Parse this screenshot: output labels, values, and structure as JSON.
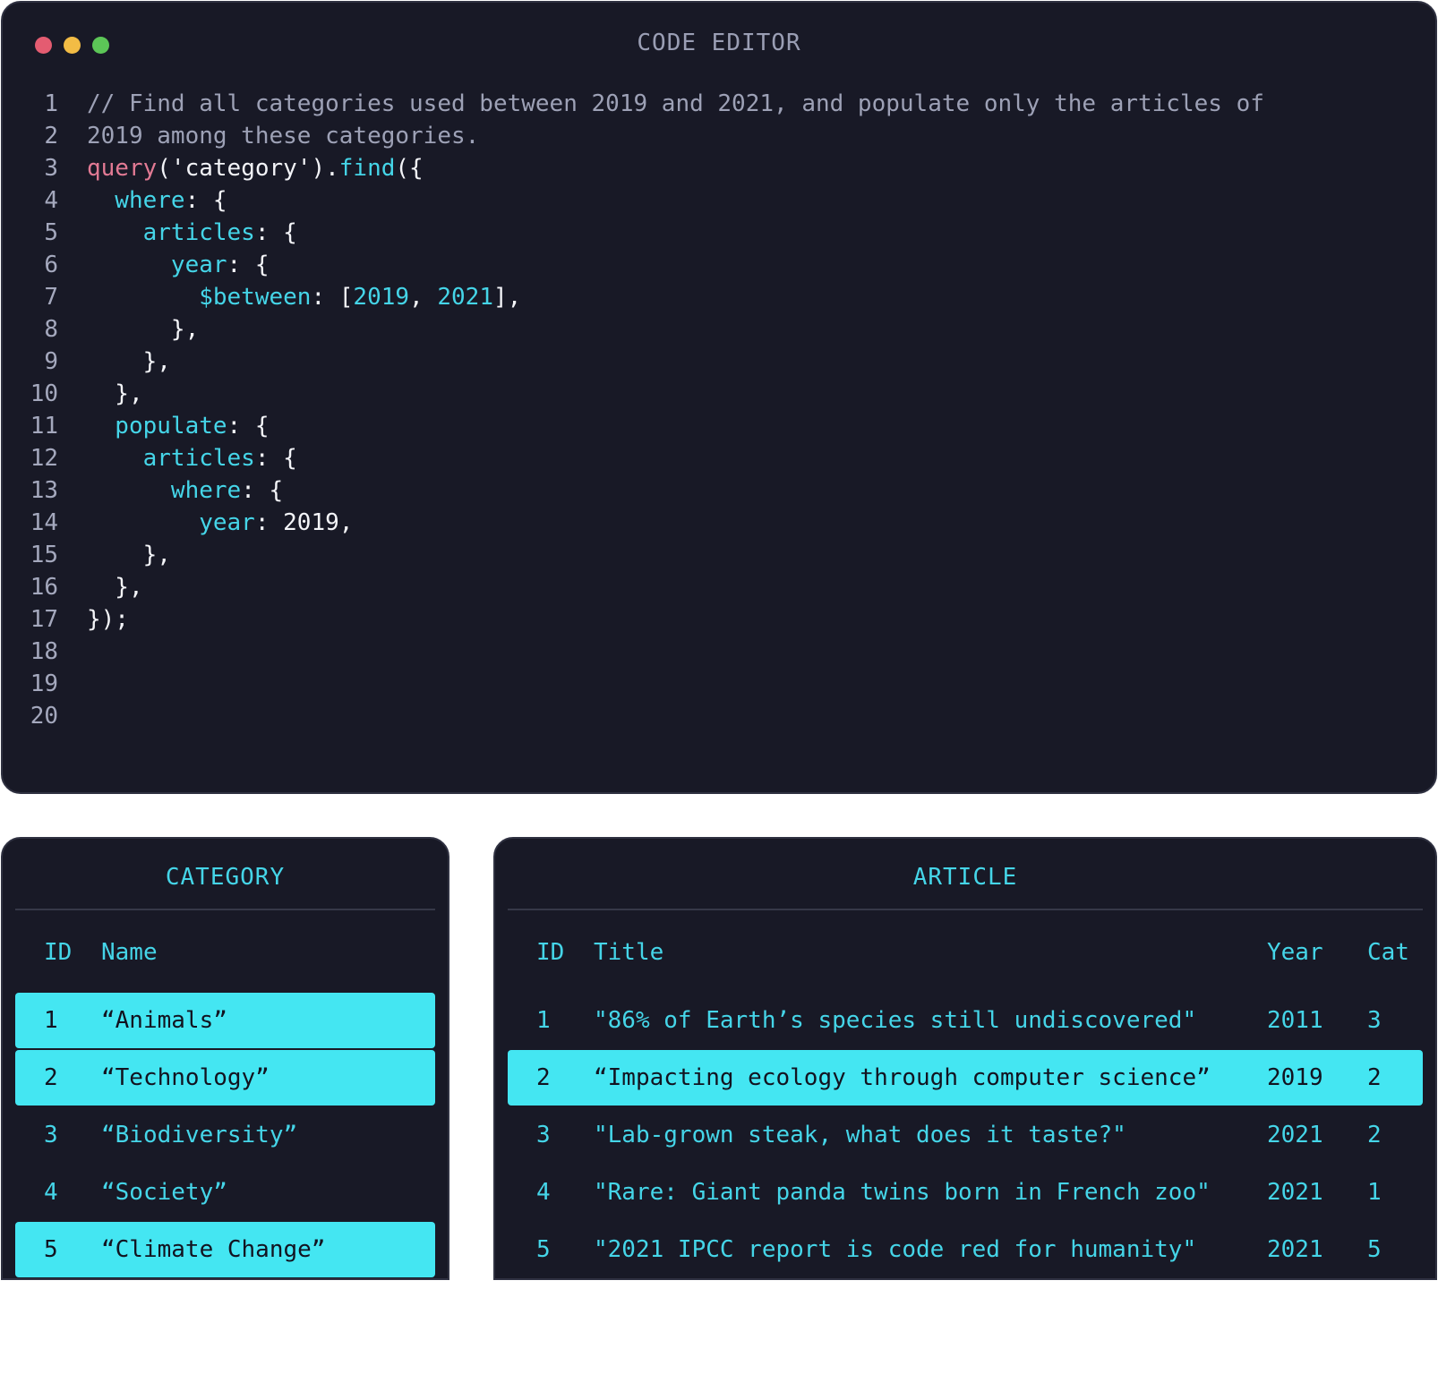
{
  "editor": {
    "title": "CODE EDITOR",
    "dot_colors": [
      "#e45c71",
      "#f2bc45",
      "#5cc657"
    ],
    "line_numbers": [
      "1",
      "2",
      "3",
      "4",
      "5",
      "6",
      "7",
      "8",
      "9",
      "10",
      "11",
      "12",
      "13",
      "14",
      "15",
      "16",
      "17",
      "18",
      "19",
      "20"
    ],
    "lines": {
      "l1": "// Find all categories used between 2019 and 2021, and populate only the articles of",
      "l2": "2019 among these categories.",
      "l3a": "query",
      "l3b": "('category').",
      "l3c": "find",
      "l3d": "({",
      "l4a": "  where",
      "l4b": ": {",
      "l5a": "    articles",
      "l5b": ": {",
      "l6a": "      year",
      "l6b": ": {",
      "l7a": "        $between",
      "l7b": ": [",
      "l7c": "2019",
      "l7d": ", ",
      "l7e": "2021",
      "l7f": "],",
      "l8": "      },",
      "l9": "    },",
      "l10": "  },",
      "l11a": "  populate",
      "l11b": ": {",
      "l12a": "    articles",
      "l12b": ": {",
      "l13a": "      where",
      "l13b": ": {",
      "l14a": "        year",
      "l14b": ": 2019,",
      "l15": "    },",
      "l16": "  },",
      "l17": "});"
    }
  },
  "category": {
    "title": "CATEGORY",
    "headers": {
      "id": "ID",
      "name": "Name"
    },
    "rows": [
      {
        "id": "1",
        "name": "“Animals”",
        "highlighted": true
      },
      {
        "id": "2",
        "name": "“Technology”",
        "highlighted": true
      },
      {
        "id": "3",
        "name": "“Biodiversity”",
        "highlighted": false
      },
      {
        "id": "4",
        "name": "“Society”",
        "highlighted": false
      },
      {
        "id": "5",
        "name": "“Climate Change”",
        "highlighted": true
      }
    ]
  },
  "article": {
    "title": "ARTICLE",
    "headers": {
      "id": "ID",
      "title": "Title",
      "year": "Year",
      "cat": "Cat"
    },
    "rows": [
      {
        "id": "1",
        "title": "\"86% of Earth’s species still undiscovered\"",
        "year": "2011",
        "cat": "3",
        "highlighted": false
      },
      {
        "id": "2",
        "title": "“Impacting ecology through computer science”",
        "year": "2019",
        "cat": "2",
        "highlighted": true
      },
      {
        "id": "3",
        "title": "\"Lab-grown steak, what does it taste?\"",
        "year": "2021",
        "cat": "2",
        "highlighted": false
      },
      {
        "id": "4",
        "title": "\"Rare: Giant panda twins born in French zoo\"",
        "year": "2021",
        "cat": "1",
        "highlighted": false
      },
      {
        "id": "5",
        "title": "\"2021 IPCC report is code red for humanity\"",
        "year": "2021",
        "cat": "5",
        "highlighted": false
      }
    ]
  }
}
